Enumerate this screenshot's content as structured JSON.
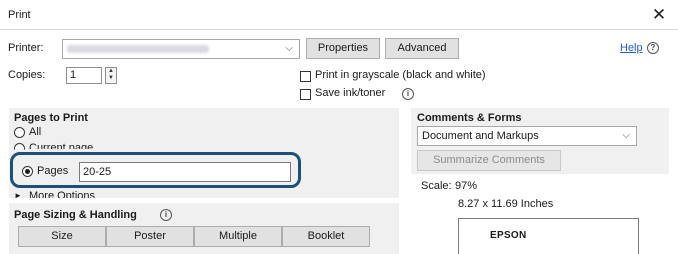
{
  "window": {
    "title": "Print",
    "close_glyph": "✕"
  },
  "printer": {
    "label": "Printer:",
    "properties_button": "Properties",
    "advanced_button": "Advanced",
    "help_link": "Help",
    "help_icon": "?"
  },
  "copies": {
    "label": "Copies:",
    "value": "1"
  },
  "options": {
    "grayscale_label": "Print in grayscale (black and white)",
    "save_ink_label": "Save ink/toner",
    "info_icon": "i"
  },
  "pages_to_print": {
    "heading": "Pages to Print",
    "all_label": "All",
    "current_page_label": "Current page",
    "pages_label": "Pages",
    "pages_value": "20-25",
    "more_options_label": "More Options",
    "more_options_icon": "►"
  },
  "sizing": {
    "heading": "Page Sizing & Handling",
    "info_icon": "i",
    "buttons": [
      "Size",
      "Poster",
      "Multiple",
      "Booklet"
    ]
  },
  "comments_forms": {
    "heading": "Comments & Forms",
    "selected": "Document and Markups",
    "summarize_button": "Summarize Comments"
  },
  "preview": {
    "scale_label": "Scale:",
    "scale_value": "97%",
    "page_size": "8.27 x 11.69 Inches",
    "brand_text": "EPSON"
  },
  "colors": {
    "highlight": "#1d4f78",
    "link": "#1f5ad6",
    "panel": "#f0f0f0"
  }
}
